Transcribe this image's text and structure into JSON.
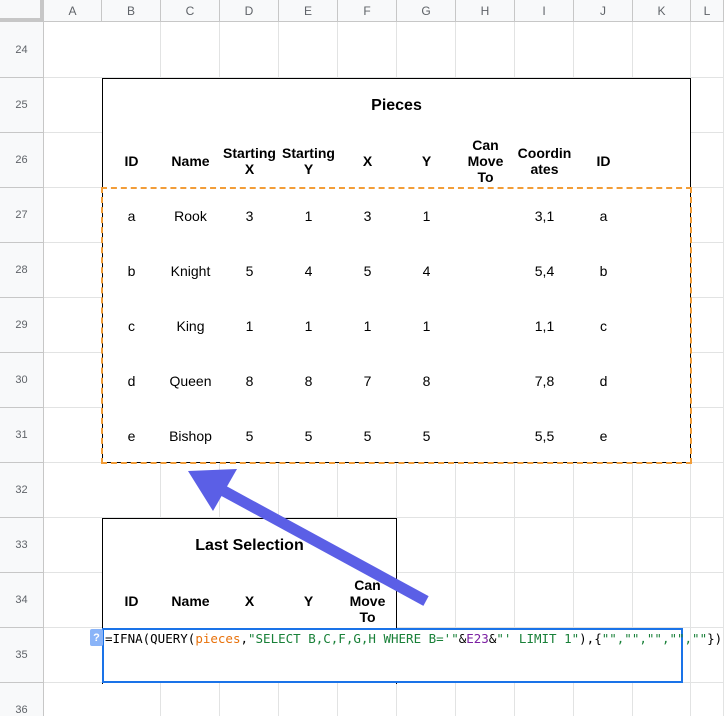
{
  "columns": [
    "A",
    "B",
    "C",
    "D",
    "E",
    "F",
    "G",
    "H",
    "I",
    "J",
    "K",
    "L"
  ],
  "rows": [
    "24",
    "25",
    "26",
    "27",
    "28",
    "29",
    "30",
    "31",
    "32",
    "33",
    "34",
    "35",
    "36"
  ],
  "pieces_table": {
    "title": "Pieces",
    "headers": [
      "ID",
      "Name",
      "Starting X",
      "Starting Y",
      "X",
      "Y",
      "Can Move To",
      "Coordinates",
      "ID"
    ],
    "header_display": [
      "ID",
      "Name",
      "Starting\nX",
      "Starting\nY",
      "X",
      "Y",
      "Can\nMove\nTo",
      "Coordin\nates",
      "ID"
    ],
    "rows": [
      [
        "a",
        "Rook",
        "3",
        "1",
        "3",
        "1",
        "",
        "3,1",
        "a"
      ],
      [
        "b",
        "Knight",
        "5",
        "4",
        "5",
        "4",
        "",
        "5,4",
        "b"
      ],
      [
        "c",
        "King",
        "1",
        "1",
        "1",
        "1",
        "",
        "1,1",
        "c"
      ],
      [
        "d",
        "Queen",
        "8",
        "8",
        "7",
        "8",
        "",
        "7,8",
        "d"
      ],
      [
        "e",
        "Bishop",
        "5",
        "5",
        "5",
        "5",
        "",
        "5,5",
        "e"
      ]
    ]
  },
  "last_selection_table": {
    "title": "Last Selection",
    "headers": [
      "ID",
      "Name",
      "X",
      "Y",
      "Can Move To"
    ],
    "header_display": [
      "ID",
      "Name",
      "X",
      "Y",
      "Can\nMove\nTo"
    ]
  },
  "formula_editor": {
    "help_label": "?",
    "formula": "=IFNA(QUERY(pieces,\"SELECT B,C,F,G,H WHERE B='\"&E23&\"' LIMIT 1\"),{\"\",\"\",\"\",\"\",\"\"})",
    "parts": [
      "=IFNA(QUERY(",
      "pieces",
      ",",
      "\"SELECT B,C,F,G,H WHERE B='\"",
      "&",
      "E23",
      "&",
      "\"' LIMIT 1\"",
      "),{",
      "\"\",\"\",\"\",\"\",\"\"",
      "})"
    ]
  },
  "colors": {
    "selection_dash": "#f29d38",
    "editor_border": "#1a73e8",
    "arrow": "#5b5fe6",
    "range_ref": "#e8710a",
    "string": "#188038",
    "cell_ref": "#7b1fa2"
  }
}
